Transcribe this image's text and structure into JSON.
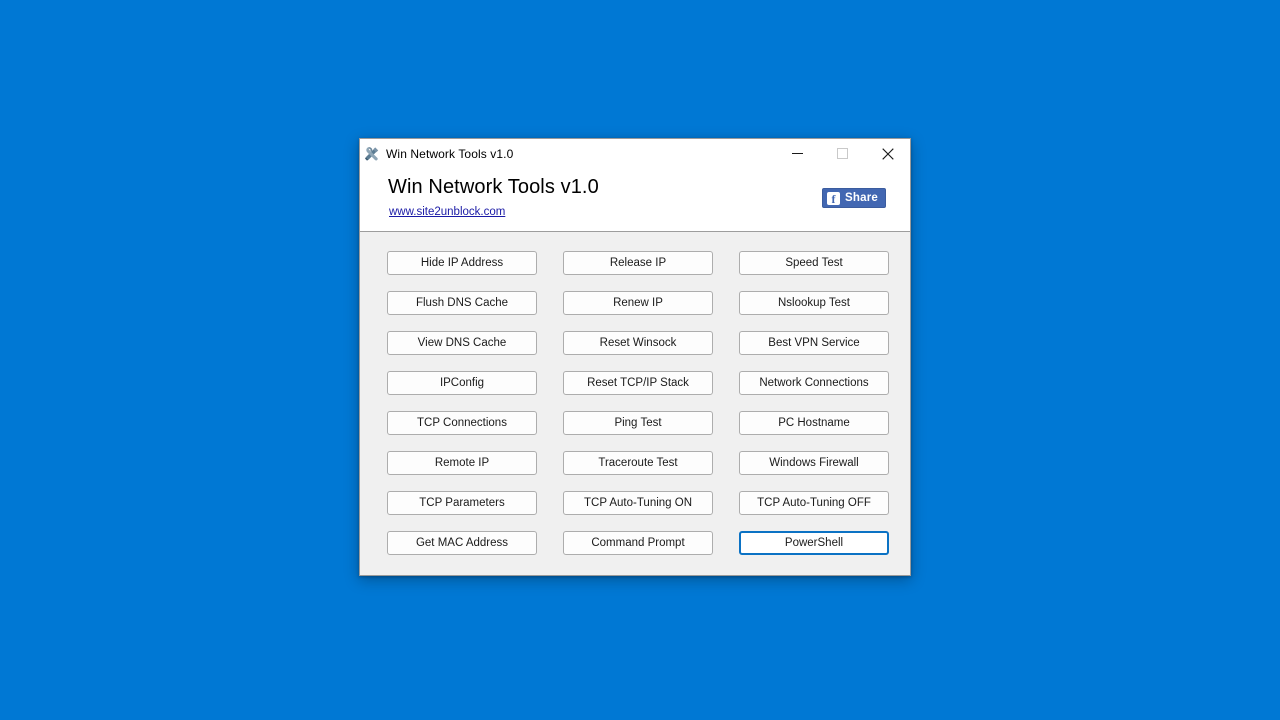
{
  "desktop": {
    "background_color": "#0078d4"
  },
  "window": {
    "titlebar": {
      "icon": "tools-wrench-screwdriver-icon",
      "title": "Win Network Tools v1.0",
      "minimize_label": "—",
      "maximize_label": "□",
      "close_label": "✕"
    },
    "header": {
      "app_title": "Win Network Tools v1.0",
      "site_link": "www.site2unblock.com",
      "share": {
        "label": "Share",
        "icon": "facebook-f-icon",
        "brand_color": "#4267b2"
      }
    },
    "buttons": [
      {
        "label": "Hide IP Address",
        "focused": false
      },
      {
        "label": "Release IP",
        "focused": false
      },
      {
        "label": "Speed Test",
        "focused": false
      },
      {
        "label": "Flush DNS Cache",
        "focused": false
      },
      {
        "label": "Renew IP",
        "focused": false
      },
      {
        "label": "Nslookup Test",
        "focused": false
      },
      {
        "label": "View DNS Cache",
        "focused": false
      },
      {
        "label": "Reset Winsock",
        "focused": false
      },
      {
        "label": "Best VPN Service",
        "focused": false
      },
      {
        "label": "IPConfig",
        "focused": false
      },
      {
        "label": "Reset TCP/IP Stack",
        "focused": false
      },
      {
        "label": "Network Connections",
        "focused": false
      },
      {
        "label": "TCP Connections",
        "focused": false
      },
      {
        "label": "Ping Test",
        "focused": false
      },
      {
        "label": "PC Hostname",
        "focused": false
      },
      {
        "label": "Remote IP",
        "focused": false
      },
      {
        "label": "Traceroute Test",
        "focused": false
      },
      {
        "label": "Windows Firewall",
        "focused": false
      },
      {
        "label": "TCP Parameters",
        "focused": false
      },
      {
        "label": "TCP Auto-Tuning ON",
        "focused": false
      },
      {
        "label": "TCP Auto-Tuning OFF",
        "focused": false
      },
      {
        "label": "Get MAC Address",
        "focused": false
      },
      {
        "label": "Command Prompt",
        "focused": false
      },
      {
        "label": "PowerShell",
        "focused": true
      }
    ],
    "colors": {
      "body_background": "#f0f0f0",
      "button_border": "#adadad",
      "focus_border": "#0b72c4",
      "link_color": "#1a1aa6"
    }
  }
}
